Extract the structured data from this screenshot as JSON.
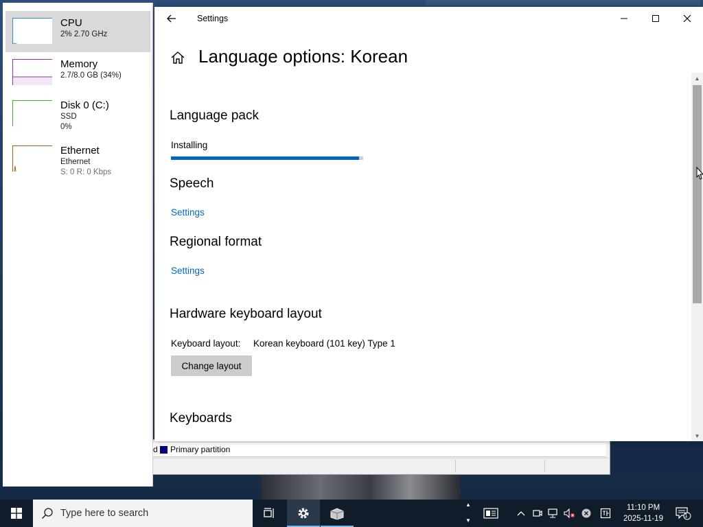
{
  "task_manager": {
    "items": [
      {
        "title": "CPU",
        "line1": "2% 2.70 GHz",
        "line2": ""
      },
      {
        "title": "Memory",
        "line1": "2.7/8.0 GB (34%)",
        "line2": ""
      },
      {
        "title": "Disk 0 (C:)",
        "line1": "SSD",
        "line2": "0%"
      },
      {
        "title": "Ethernet",
        "line1": "Ethernet",
        "line2": "S: 0 R: 0 Kbps"
      }
    ],
    "colors": {
      "cpu": "#2d8fd8",
      "memory": "#9b2fae",
      "disk": "#4ca82f",
      "ethernet": "#a85f1e"
    }
  },
  "settings": {
    "app_title": "Settings",
    "page_title": "Language options: Korean",
    "language_pack": {
      "heading": "Language pack",
      "status": "Installing",
      "progress": 0.98
    },
    "speech": {
      "heading": "Speech",
      "link": "Settings"
    },
    "regional": {
      "heading": "Regional format",
      "link": "Settings"
    },
    "hardware_keyboard": {
      "heading": "Hardware keyboard layout",
      "label": "Keyboard layout:",
      "value": "Korean keyboard (101 key) Type 1",
      "button": "Change layout"
    },
    "keyboards": {
      "heading": "Keyboards"
    },
    "accent": "#0067c0"
  },
  "background_window": {
    "legend": "Primary partition",
    "prefix": "d"
  },
  "taskbar": {
    "search_placeholder": "Type here to search",
    "clock_time": "11:10 PM",
    "clock_date": "2025-11-19",
    "notification_count": "1"
  }
}
